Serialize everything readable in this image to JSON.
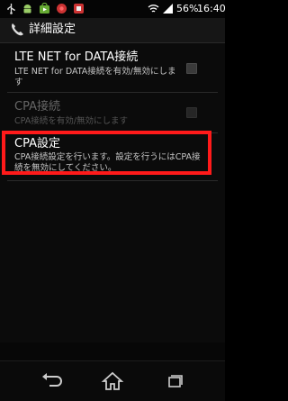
{
  "status_bar": {
    "icons": [
      "usb-icon",
      "android-debug-icon",
      "market-icon",
      "location-icon",
      "app-icon",
      "wifi-icon",
      "signal-icon"
    ],
    "battery": "56%",
    "time": "16:40"
  },
  "action_bar": {
    "icon": "phone-settings-icon",
    "title": "詳細設定"
  },
  "preferences": [
    {
      "title": "LTE NET for DATA接続",
      "summary": "LTE NET for DATA接続を有効/無効にします",
      "has_checkbox": true,
      "enabled": true
    },
    {
      "title": "CPA接続",
      "summary": "CPA接続を有効/無効にします",
      "has_checkbox": true,
      "enabled": false
    },
    {
      "title": "CPA設定",
      "summary": "CPA接続設定を行います。設定を行うにはCPA接続を無効にしてください。",
      "has_checkbox": false,
      "enabled": true,
      "highlighted": true
    }
  ],
  "highlight_color": "#ff1a1a",
  "nav_bar": {
    "buttons": [
      "back-icon",
      "home-icon",
      "recent-apps-icon"
    ]
  }
}
